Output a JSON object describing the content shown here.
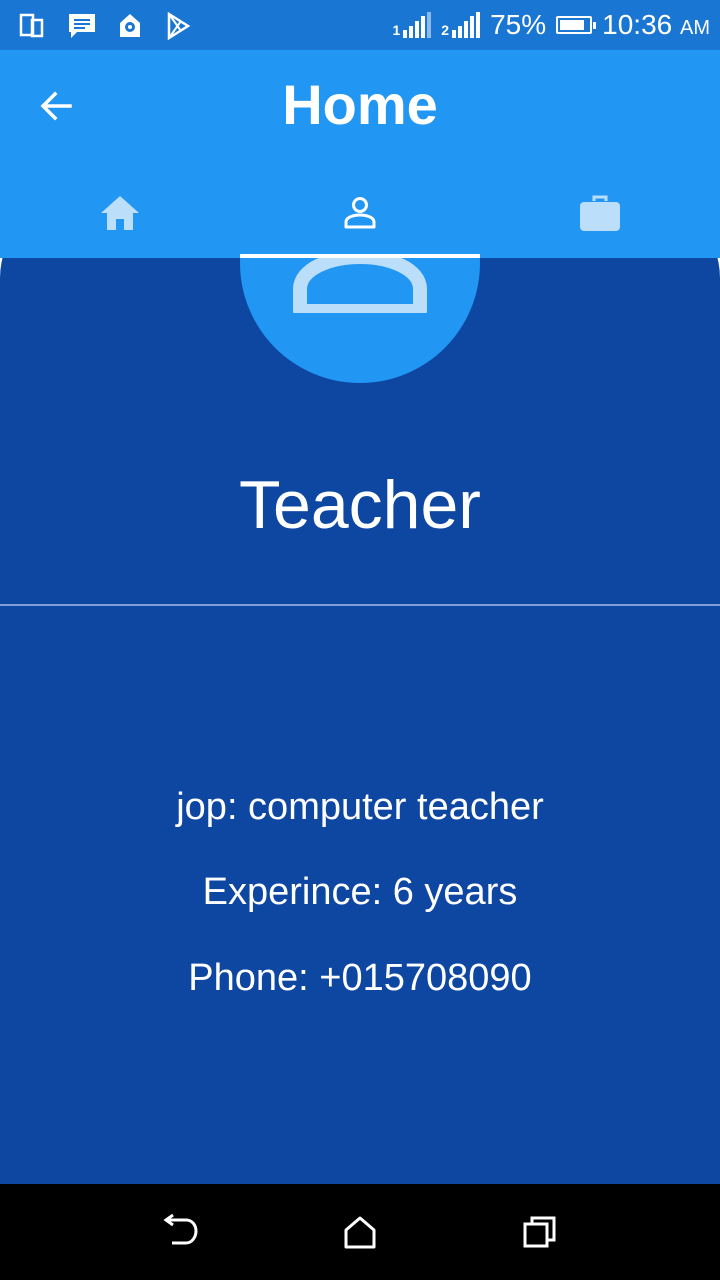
{
  "status_bar": {
    "battery_percent": "75%",
    "time": "10:36",
    "ampm": "AM",
    "sim1": "1",
    "sim2": "2",
    "battery_level": 0.75
  },
  "app_bar": {
    "title": "Home",
    "tabs": [
      {
        "icon": "home-icon",
        "active": false
      },
      {
        "icon": "person-icon",
        "active": true
      },
      {
        "icon": "briefcase-icon",
        "active": false
      }
    ]
  },
  "profile": {
    "role": "Teacher",
    "job": "jop: computer teacher",
    "experience": "Experince: 6 years",
    "phone": "Phone: +015708090"
  },
  "colors": {
    "status_bar": "#1976d2",
    "app_bar": "#2196f3",
    "card": "#0d47a1",
    "tab_icon_inactive": "#bbdefb"
  }
}
